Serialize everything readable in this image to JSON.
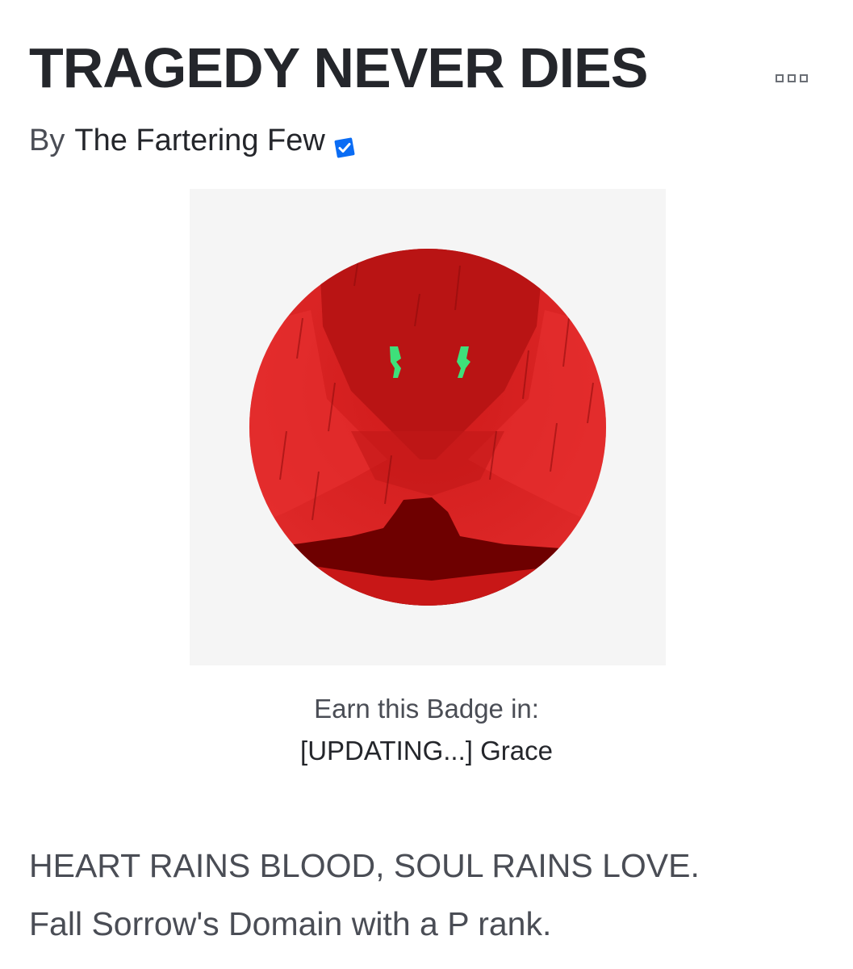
{
  "badge": {
    "title": "TRAGEDY NEVER DIES",
    "by_label": "By",
    "creator": "The Fartering Few",
    "earn_label": "Earn this Badge in:",
    "game_name": "[UPDATING...] Grace",
    "description_lines": [
      "HEART RAINS BLOOD, SOUL RAINS LOVE.",
      "Fall Sorrow's Domain with a P rank."
    ]
  },
  "icons": {
    "more": "more-options-icon",
    "verified": "verified-badge-icon",
    "badge_image": "badge-image"
  },
  "colors": {
    "title": "#24262b",
    "secondary_text": "#4a4d55",
    "verified_blue": "#0a6cf4",
    "badge_red": "#d91f1f",
    "badge_dark_red": "#6e0000",
    "badge_eyes": "#3ee07a",
    "image_background": "#f5f5f5"
  }
}
